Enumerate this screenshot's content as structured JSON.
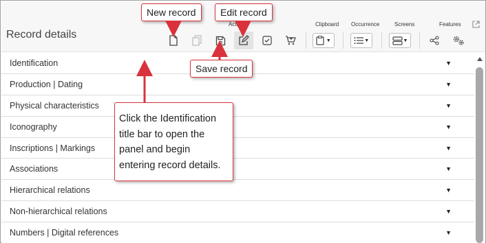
{
  "header": {
    "title": "Record details",
    "groups": {
      "actions": "Actions",
      "clipboard": "Clipboard",
      "occurrence": "Occurrence",
      "screens": "Screens",
      "features": "Features"
    }
  },
  "icons": {
    "new": "new-record-icon",
    "copy": "copy-record-icon",
    "save": "save-icon",
    "edit": "edit-icon",
    "check": "check-icon",
    "cart": "cart-icon",
    "clipboard": "clipboard-icon",
    "list": "list-icon",
    "screens": "screens-icon",
    "share": "share-icon",
    "settings": "settings-icon",
    "popout": "popout-icon"
  },
  "panels": [
    {
      "label": "Identification"
    },
    {
      "label": "Production | Dating"
    },
    {
      "label": "Physical characteristics"
    },
    {
      "label": "Iconography"
    },
    {
      "label": "Inscriptions | Markings"
    },
    {
      "label": "Associations"
    },
    {
      "label": "Hierarchical relations"
    },
    {
      "label": "Non-hierarchical relations"
    },
    {
      "label": "Numbers | Digital references"
    }
  ],
  "callouts": {
    "new_record": "New record",
    "edit_record": "Edit record",
    "save_record": "Save record",
    "instruction": "Click the Identification title bar to open the panel and begin entering record details."
  },
  "colors": {
    "callout_border": "#d9323c",
    "arrow": "#d9323c"
  }
}
